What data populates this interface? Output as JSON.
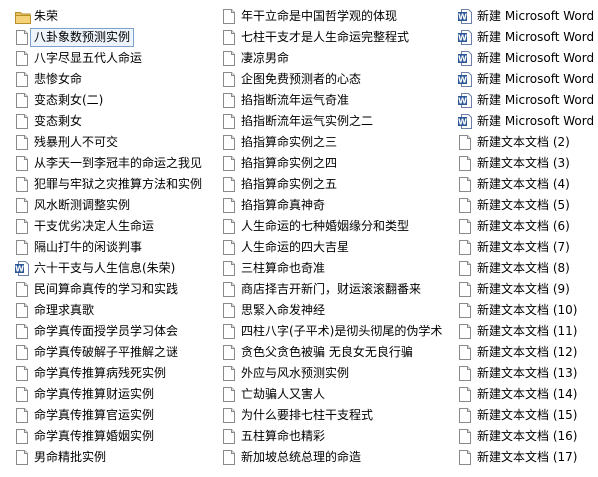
{
  "files": {
    "column1": [
      {
        "label": "朱荣",
        "icon": "folder-icon"
      },
      {
        "label": "八卦象数预测实例",
        "icon": "text-file-icon",
        "selected": true
      },
      {
        "label": "八字尽显五代人命运",
        "icon": "text-file-icon"
      },
      {
        "label": "悲惨女命",
        "icon": "text-file-icon"
      },
      {
        "label": "变态剩女(二)",
        "icon": "text-file-icon"
      },
      {
        "label": "变态剩女",
        "icon": "text-file-icon"
      },
      {
        "label": "残暴刑人不可交",
        "icon": "text-file-icon"
      },
      {
        "label": "从李天一到李冠丰的命运之我见",
        "icon": "text-file-icon"
      },
      {
        "label": "犯罪与牢狱之灾推算方法和实例",
        "icon": "text-file-icon"
      },
      {
        "label": "风水断测调整实例",
        "icon": "text-file-icon"
      },
      {
        "label": "干支优劣决定人生命运",
        "icon": "text-file-icon"
      },
      {
        "label": "隔山打牛的闲谈判事",
        "icon": "text-file-icon"
      },
      {
        "label": "六十干支与人生信息(朱荣)",
        "icon": "word-document-icon"
      },
      {
        "label": "民间算命真传的学习和实践",
        "icon": "text-file-icon"
      },
      {
        "label": "命理求真歌",
        "icon": "text-file-icon"
      },
      {
        "label": "命学真传面授学员学习体会",
        "icon": "text-file-icon"
      },
      {
        "label": "命学真传破解子平推解之谜",
        "icon": "text-file-icon"
      },
      {
        "label": "命学真传推算病残死实例",
        "icon": "text-file-icon"
      },
      {
        "label": "命学真传推算财运实例",
        "icon": "text-file-icon"
      },
      {
        "label": "命学真传推算官运实例",
        "icon": "text-file-icon"
      },
      {
        "label": "命学真传推算婚姻实例",
        "icon": "text-file-icon"
      },
      {
        "label": "男命精批实例",
        "icon": "text-file-icon"
      }
    ],
    "column2": [
      {
        "label": "年干立命是中国哲学观的体现",
        "icon": "text-file-icon"
      },
      {
        "label": "七柱干支才是人生命运完整程式",
        "icon": "text-file-icon"
      },
      {
        "label": "凄凉男命",
        "icon": "text-file-icon"
      },
      {
        "label": "企图免费预测者的心态",
        "icon": "text-file-icon"
      },
      {
        "label": "掐指断流年运气奇准",
        "icon": "text-file-icon"
      },
      {
        "label": "掐指断流年运气实例之二",
        "icon": "text-file-icon"
      },
      {
        "label": "掐指算命实例之三",
        "icon": "text-file-icon"
      },
      {
        "label": "掐指算命实例之四",
        "icon": "text-file-icon"
      },
      {
        "label": "掐指算命实例之五",
        "icon": "text-file-icon"
      },
      {
        "label": "掐指算命真神奇",
        "icon": "text-file-icon"
      },
      {
        "label": "人生命运的七种婚姻缘分和类型",
        "icon": "text-file-icon"
      },
      {
        "label": "人生命运的四大吉星",
        "icon": "text-file-icon"
      },
      {
        "label": "三柱算命也奇准",
        "icon": "text-file-icon"
      },
      {
        "label": "商店择吉开新门，财运滚滚翻番来",
        "icon": "text-file-icon"
      },
      {
        "label": "思緊入命发神经",
        "icon": "text-file-icon"
      },
      {
        "label": "四柱八字(子平术)是彻头彻尾的伪学术",
        "icon": "text-file-icon"
      },
      {
        "label": "贪色父贪色被骗  无良女无良行骗",
        "icon": "text-file-icon"
      },
      {
        "label": "外应与风水预测实例",
        "icon": "text-file-icon"
      },
      {
        "label": "亡劫骗人又害人",
        "icon": "text-file-icon"
      },
      {
        "label": "为什么要排七柱干支程式",
        "icon": "text-file-icon"
      },
      {
        "label": "五柱算命也精彩",
        "icon": "text-file-icon"
      },
      {
        "label": "新加坡总统总理的命造",
        "icon": "text-file-icon"
      }
    ],
    "column3": [
      {
        "label": "新建 Microsoft Word",
        "icon": "word-document-icon"
      },
      {
        "label": "新建 Microsoft Word",
        "icon": "word-document-icon"
      },
      {
        "label": "新建 Microsoft Word",
        "icon": "word-document-icon"
      },
      {
        "label": "新建 Microsoft Word",
        "icon": "word-document-icon"
      },
      {
        "label": "新建 Microsoft Word",
        "icon": "word-document-icon"
      },
      {
        "label": "新建 Microsoft Word",
        "icon": "word-document-icon"
      },
      {
        "label": "新建文本文档 (2)",
        "icon": "text-file-icon"
      },
      {
        "label": "新建文本文档 (3)",
        "icon": "text-file-icon"
      },
      {
        "label": "新建文本文档 (4)",
        "icon": "text-file-icon"
      },
      {
        "label": "新建文本文档 (5)",
        "icon": "text-file-icon"
      },
      {
        "label": "新建文本文档 (6)",
        "icon": "text-file-icon"
      },
      {
        "label": "新建文本文档 (7)",
        "icon": "text-file-icon"
      },
      {
        "label": "新建文本文档 (8)",
        "icon": "text-file-icon"
      },
      {
        "label": "新建文本文档 (9)",
        "icon": "text-file-icon"
      },
      {
        "label": "新建文本文档 (10)",
        "icon": "text-file-icon"
      },
      {
        "label": "新建文本文档 (11)",
        "icon": "text-file-icon"
      },
      {
        "label": "新建文本文档 (12)",
        "icon": "text-file-icon"
      },
      {
        "label": "新建文本文档 (13)",
        "icon": "text-file-icon"
      },
      {
        "label": "新建文本文档 (14)",
        "icon": "text-file-icon"
      },
      {
        "label": "新建文本文档 (15)",
        "icon": "text-file-icon"
      },
      {
        "label": "新建文本文档 (16)",
        "icon": "text-file-icon"
      },
      {
        "label": "新建文本文档 (17)",
        "icon": "text-file-icon"
      }
    ]
  },
  "colors": {
    "selection_border": "#7da2ce",
    "selection_fill": "#eef4fb",
    "folder": "#e8c060",
    "word_blue": "#2b5797"
  }
}
